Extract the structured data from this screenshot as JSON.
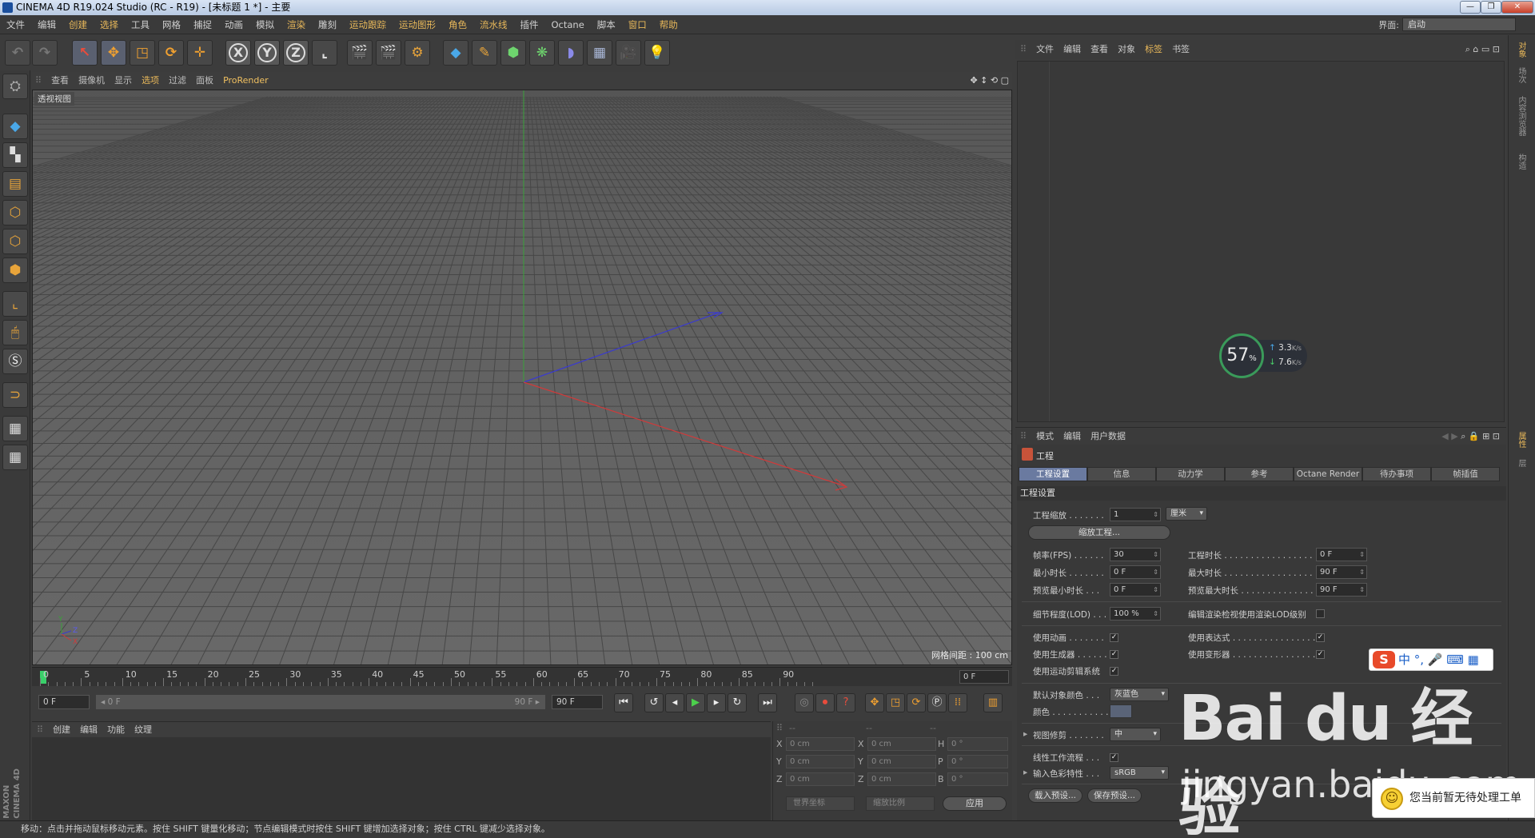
{
  "window": {
    "title": "CINEMA 4D R19.024 Studio (RC - R19) - [未标题 1 *] - 主要",
    "controls": [
      "—",
      "❐",
      "✕"
    ]
  },
  "menubar": {
    "items": [
      "文件",
      "编辑",
      "创建",
      "选择",
      "工具",
      "网格",
      "捕捉",
      "动画",
      "模拟",
      "渲染",
      "雕刻",
      "运动跟踪",
      "运动图形",
      "角色",
      "流水线",
      "插件",
      "Octane",
      "脚本",
      "窗口",
      "帮助"
    ],
    "layout_label": "界面:",
    "layout_value": "启动"
  },
  "viewport": {
    "menu": [
      "查看",
      "摄像机",
      "显示",
      "选项",
      "过滤",
      "面板",
      "ProRender"
    ],
    "label": "透视视图",
    "grid_spacing": "网格间距 : 100 cm",
    "nav_icons": [
      "✥",
      "↕",
      "⟲",
      "▢"
    ]
  },
  "timeline": {
    "ticks": [
      "0",
      "5",
      "10",
      "15",
      "20",
      "25",
      "30",
      "35",
      "40",
      "45",
      "50",
      "55",
      "60",
      "65",
      "70",
      "75",
      "80",
      "85",
      "90"
    ],
    "frame": "0 F"
  },
  "playback": {
    "start": "0 F",
    "range_start": "◂ 0 F",
    "range_end": "90 F ▸",
    "end": "90 F"
  },
  "material_manager": {
    "menu": [
      "创建",
      "编辑",
      "功能",
      "纹理"
    ]
  },
  "coordinates": {
    "headers": [
      "--",
      "--",
      "--"
    ],
    "rows": [
      {
        "a": "X",
        "av": "0 cm",
        "b": "X",
        "bv": "0 cm",
        "c": "H",
        "cv": "0 °"
      },
      {
        "a": "Y",
        "av": "0 cm",
        "b": "Y",
        "bv": "0 cm",
        "c": "P",
        "cv": "0 °"
      },
      {
        "a": "Z",
        "av": "0 cm",
        "b": "Z",
        "bv": "0 cm",
        "c": "B",
        "cv": "0 °"
      }
    ],
    "mode1": "世界坐标",
    "mode2": "缩放比例",
    "apply": "应用"
  },
  "status": "移动：点击并拖动鼠标移动元素。按住 SHIFT 键量化移动；节点编辑模式时按住 SHIFT 键增加选择对象；按住 CTRL 键减少选择对象。",
  "object_manager": {
    "menu": [
      "文件",
      "编辑",
      "查看",
      "对象",
      "标签",
      "书签"
    ]
  },
  "speed_widget": {
    "percent": "57",
    "percent_unit": "%",
    "up": "3.3",
    "down": "7.6",
    "unit": "K/s"
  },
  "attribute_manager": {
    "menu": [
      "模式",
      "编辑",
      "用户数据"
    ],
    "title": "工程",
    "tabs": [
      "工程设置",
      "信息",
      "动力学",
      "参考",
      "Octane Render",
      "待办事项",
      "帧插值"
    ],
    "section": "工程设置",
    "scale_label": "工程缩放 . . . . . . .",
    "scale_value": "1",
    "scale_unit": "厘米",
    "scale_btn": "缩放工程...",
    "fps_label": "帧率(FPS) . . . . . .",
    "fps_value": "30",
    "proj_len_label": "工程时长 . . . . . . . . . . . . . . . . . .",
    "proj_len_value": "0 F",
    "min_len_label": "最小时长 . . . . . . .",
    "min_len_value": "0 F",
    "max_len_label": "最大时长 . . . . . . . . . . . . . . . . . .",
    "max_len_value": "90 F",
    "pmin_label": "预览最小时长 . . .",
    "pmin_value": "0 F",
    "pmax_label": "预览最大时长 . . . . . . . . . . . . . . .",
    "pmax_value": "90 F",
    "lod_label": "细节程度(LOD) . . .",
    "lod_value": "100 %",
    "render_lod_label": "编辑渲染检视使用渲染LOD级别",
    "use_anim_label": "使用动画 . . . . . . .",
    "use_expr_label": "使用表达式 . . . . . . . . . . . . . . . . .",
    "use_gen_label": "使用生成器 . . . . . .",
    "use_def_label": "使用变形器 . . . . . . . . . . . . . . . . .",
    "use_motion_label": "使用运动剪辑系统",
    "def_color_label": "默认对象颜色 . . .",
    "def_color_value": "灰蓝色",
    "color_label": "颜色 . . . . . . . . . . .",
    "view_clip_label": "视图修剪 . . . . . . .",
    "view_clip_value": "中",
    "linear_label": "线性工作流程 . . .",
    "input_color_label": "输入色彩特性 . . .",
    "input_color_value": "sRGB",
    "load_preset": "载入预设...",
    "save_preset": "保存预设..."
  },
  "right_tabs": [
    "对象",
    "场次",
    "内容浏览器",
    "构造",
    "属性",
    "层"
  ],
  "ime": {
    "text": "中 °, 🎤 ⌨ ▦"
  },
  "watermark": {
    "brand": "Bai du 经验",
    "url": "jingyan.baidu.com"
  },
  "toast": "您当前暂无待处理工单"
}
